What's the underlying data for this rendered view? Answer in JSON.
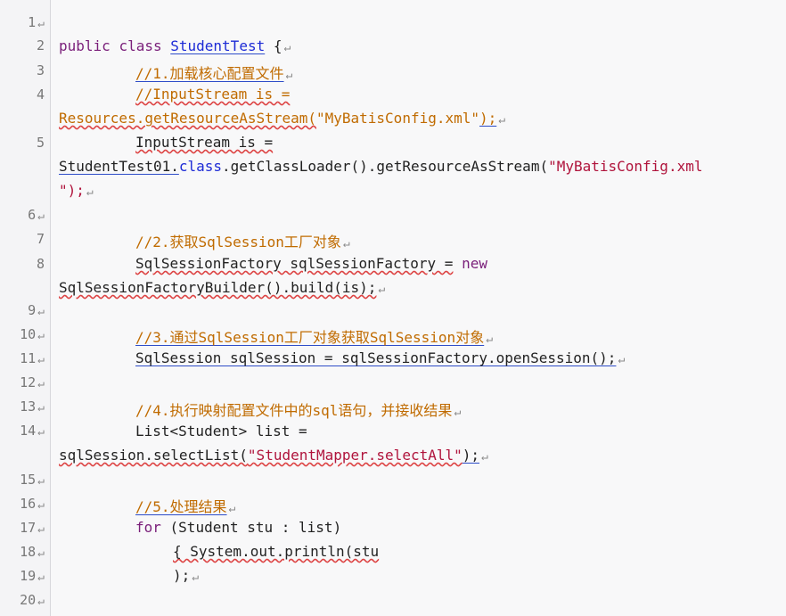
{
  "editor": {
    "line_numbers": [
      "1",
      "2",
      "3",
      "4",
      "5",
      "6",
      "7",
      "8",
      "9",
      "10",
      "11",
      "12",
      "13",
      "14",
      "15",
      "16",
      "17",
      "18",
      "19",
      "20"
    ],
    "paragraph_mark": "↵",
    "code": {
      "l2a": "public",
      "l2b": "class",
      "l2c": "StudentTest",
      "l2d": " {",
      "l3": "//1.加载核心配置文件",
      "l4": "//InputStream is =",
      "l4b1": "Resources.getResourceAsStream(",
      "l4b2": "\"MyBatisConfig.xml\"",
      "l4b3": ");",
      "l5": "InputStream is =",
      "l5b1": "StudentTest01.",
      "l5b2": "class",
      "l5b3": ".getClassLoader().getResourceAsStream(",
      "l5b4": "\"MyBatisConfig.xml",
      "l5c": "\");",
      "l7": "//2.获取SqlSession工厂对象",
      "l8a": "SqlSessionFactory sqlSessionFactory =",
      "l8b": "new",
      "l8c": "SqlSessionFactoryBuilder().build(is);",
      "l10": "//3.通过SqlSession工厂对象获取SqlSession对象",
      "l11": "SqlSession sqlSession = sqlSessionFactory.openSession();",
      "l13": "//4.执行映射配置文件中的sql语句，并接收结果",
      "l14": "List<Student> list =",
      "l14b1": "sqlSession.selectList(",
      "l14b2": "\"StudentMapper.selectAll\"",
      "l14b3": ");",
      "l16": "//5.处理结果",
      "l17a": "for",
      "l17b": " (Student stu : list)",
      "l18": "{ System.out.println(stu",
      "l19": ");"
    }
  }
}
